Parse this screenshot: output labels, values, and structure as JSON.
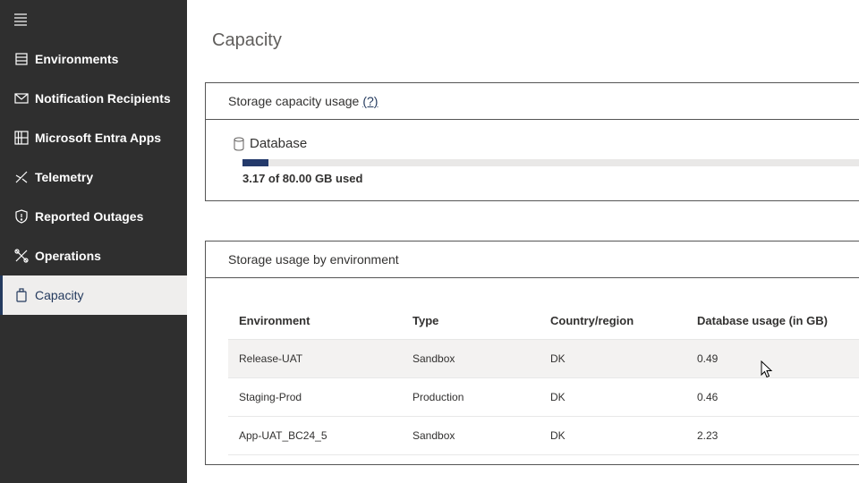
{
  "sidebar": {
    "items": [
      {
        "label": "Environments",
        "icon": "list-icon"
      },
      {
        "label": "Notification Recipients",
        "icon": "mail-icon"
      },
      {
        "label": "Microsoft Entra Apps",
        "icon": "grid-icon"
      },
      {
        "label": "Telemetry",
        "icon": "telemetry-icon"
      },
      {
        "label": "Reported Outages",
        "icon": "shield-icon"
      },
      {
        "label": "Operations",
        "icon": "tools-icon"
      },
      {
        "label": "Capacity",
        "icon": "capacity-icon",
        "active": true
      }
    ]
  },
  "page": {
    "title": "Capacity"
  },
  "storage_capacity": {
    "header": "Storage capacity usage",
    "help_link": "(?)",
    "database_label": "Database",
    "used_text": "3.17 of 80.00 GB used",
    "used_gb": 3.17,
    "total_gb": 80.0
  },
  "storage_by_env": {
    "header": "Storage usage by environment",
    "columns": [
      "Environment",
      "Type",
      "Country/region",
      "Database usage (in GB)"
    ],
    "rows": [
      {
        "environment": "Release-UAT",
        "type": "Sandbox",
        "country": "DK",
        "usage": "0.49"
      },
      {
        "environment": "Staging-Prod",
        "type": "Production",
        "country": "DK",
        "usage": "0.46"
      },
      {
        "environment": "App-UAT_BC24_5",
        "type": "Sandbox",
        "country": "DK",
        "usage": "2.23"
      }
    ]
  },
  "colors": {
    "sidebar_bg": "#2f2f2f",
    "accent": "#243a5e",
    "progress_fill": "#243a6b"
  }
}
